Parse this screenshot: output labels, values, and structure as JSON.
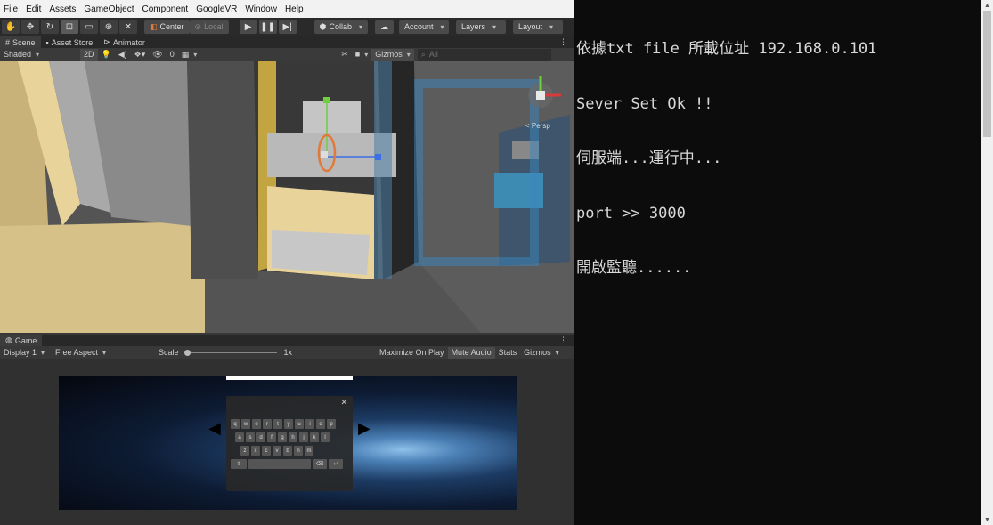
{
  "menu": [
    "File",
    "Edit",
    "Assets",
    "GameObject",
    "Component",
    "GoogleVR",
    "Window",
    "Help"
  ],
  "toolbar": {
    "center_label": "Center",
    "local_label": "Local",
    "collab_label": "Collab",
    "account_label": "Account",
    "layers_label": "Layers",
    "layout_label": "Layout"
  },
  "scene_tabs": [
    "Scene",
    "Asset Store",
    "Animator"
  ],
  "scene_options": {
    "shading": "Shaded",
    "mode_2d": "2D",
    "fx_count": "0",
    "gizmos": "Gizmos",
    "search_placeholder": "All",
    "persp_label": "< Persp"
  },
  "game_tab": "Game",
  "game_options": {
    "display": "Display 1",
    "aspect": "Free Aspect",
    "scale_label": "Scale",
    "scale_value": "1x",
    "maximize": "Maximize On Play",
    "mute": "Mute Audio",
    "stats": "Stats",
    "gizmos": "Gizmos"
  },
  "keyboard": {
    "row1": [
      "q",
      "w",
      "e",
      "r",
      "t",
      "y",
      "u",
      "i",
      "o",
      "p"
    ],
    "row2": [
      "a",
      "s",
      "d",
      "f",
      "g",
      "h",
      "j",
      "k",
      "l"
    ],
    "row3": [
      "z",
      "x",
      "c",
      "v",
      "b",
      "n",
      "m"
    ]
  },
  "console_lines": [
    "依據txt file 所載位址 192.168.0.101",
    "Sever Set Ok !!",
    "伺服端...運行中...",
    "port >> 3000",
    "開啟監聽......"
  ],
  "colors": {
    "console_bg": "#0c0c0c",
    "console_text": "#d9d9d9",
    "editor_bg": "#383838",
    "wall_yellow": "#e8d39a"
  }
}
